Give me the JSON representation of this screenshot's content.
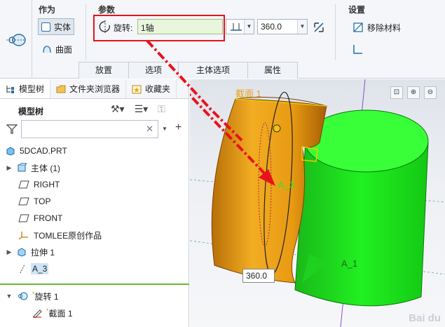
{
  "ribbon": {
    "group_as": "作为",
    "solid": "实体",
    "surface": "曲面",
    "group_params": "参数",
    "rotate_label": "旋转:",
    "axis_value": "1轴",
    "angle_value": "360.0",
    "group_settings": "设置",
    "remove_material": "移除材料",
    "tabs": [
      "放置",
      "选项",
      "主体选项",
      "属性"
    ]
  },
  "panel": {
    "tabs": [
      "模型树",
      "文件夹浏览器",
      "收藏夹"
    ],
    "tree_title": "模型树",
    "filter_value": "",
    "items": [
      {
        "label": "5DCAD.PRT"
      },
      {
        "label": "主体 (1)"
      },
      {
        "label": "RIGHT"
      },
      {
        "label": "TOP"
      },
      {
        "label": "FRONT"
      },
      {
        "label": "TOMLEE原创作品"
      },
      {
        "label": "拉伸 1"
      },
      {
        "label": "A_3"
      }
    ],
    "active_feature": "旋转 1",
    "sketch": "截面 1"
  },
  "viewport": {
    "sketch_label": "截面 1",
    "axis_label_a3": "A_3",
    "axis_label_a1": "A_1",
    "angle_popup": "360.0",
    "colors": {
      "orange": "#e8a21a",
      "green": "#18e018",
      "arrow": "#e8121b"
    }
  }
}
